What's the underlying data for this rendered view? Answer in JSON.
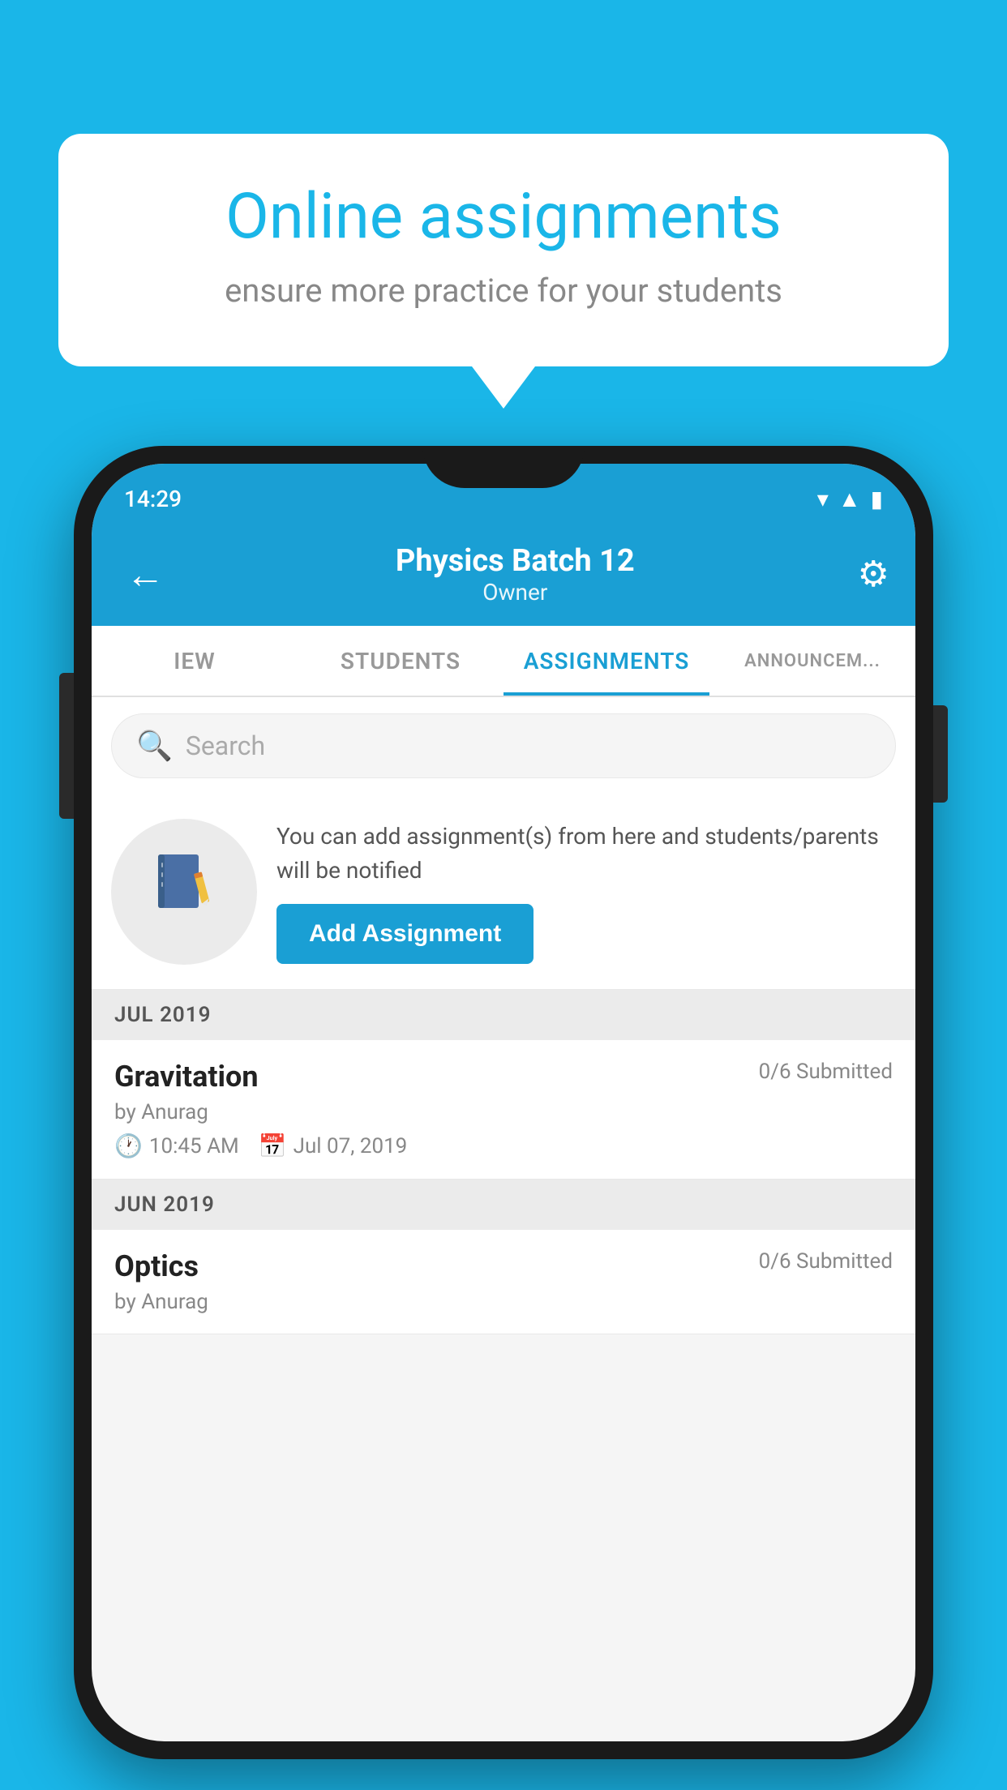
{
  "background_color": "#1ab6e8",
  "speech_bubble": {
    "title": "Online assignments",
    "subtitle": "ensure more practice for your students"
  },
  "phone": {
    "status_bar": {
      "time": "14:29",
      "icons": [
        "wifi",
        "signal",
        "battery"
      ]
    },
    "app_bar": {
      "title": "Physics Batch 12",
      "subtitle": "Owner",
      "back_label": "←",
      "settings_label": "⚙"
    },
    "tabs": [
      {
        "label": "IEW",
        "active": false
      },
      {
        "label": "STUDENTS",
        "active": false
      },
      {
        "label": "ASSIGNMENTS",
        "active": true
      },
      {
        "label": "ANNOUNCEM...",
        "active": false
      }
    ],
    "search": {
      "placeholder": "Search"
    },
    "promo": {
      "icon": "📓",
      "text": "You can add assignment(s) from here and students/parents will be notified",
      "button_label": "Add Assignment"
    },
    "sections": [
      {
        "label": "JUL 2019",
        "assignments": [
          {
            "name": "Gravitation",
            "submitted": "0/6 Submitted",
            "author": "by Anurag",
            "time": "10:45 AM",
            "date": "Jul 07, 2019"
          }
        ]
      },
      {
        "label": "JUN 2019",
        "assignments": [
          {
            "name": "Optics",
            "submitted": "0/6 Submitted",
            "author": "by Anurag",
            "time": "",
            "date": ""
          }
        ]
      }
    ]
  }
}
